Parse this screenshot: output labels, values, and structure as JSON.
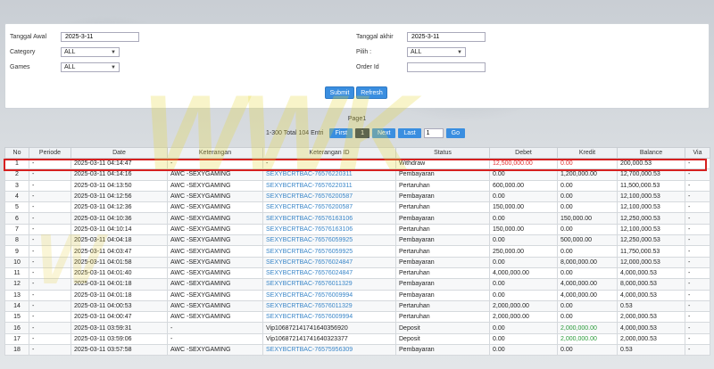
{
  "filters": {
    "tanggal_awal_label": "Tanggal Awal",
    "tanggal_awal_value": "2025-3-11",
    "tanggal_akhir_label": "Tanggal akhir",
    "tanggal_akhir_value": "2025-3-11",
    "category_label": "Category",
    "category_value": "ALL",
    "pilih_label": "Pilih :",
    "pilih_value": "ALL",
    "games_label": "Games",
    "games_value": "ALL",
    "order_id_label": "Order Id",
    "order_id_value": "",
    "submit_label": "Submit",
    "refresh_label": "Refresh"
  },
  "pager": {
    "page_label": "Page1",
    "total_text": "1-300 Total 104 Entri",
    "first": "First",
    "current": "1",
    "next": "Next",
    "last": "Last",
    "page_input": "1",
    "go": "Go"
  },
  "watermark": "WWK",
  "table": {
    "headers": [
      "No",
      "Periode",
      "Date",
      "Keterangan",
      "Keterangan ID",
      "Status",
      "Debet",
      "Kredit",
      "Balance",
      "Via"
    ],
    "rows": [
      [
        "1",
        "-",
        "2025-03-11 04:14:47",
        "-",
        "-",
        "Withdraw",
        "12,500,000.00",
        "0.00",
        "200,000.53",
        "-"
      ],
      [
        "2",
        "-",
        "2025-03-11 04:14:16",
        "AWC -SEXYGAMING",
        "SEXYBCRTBAC-76576220311",
        "Pembayaran",
        "0.00",
        "1,200,000.00",
        "12,700,000.53",
        "-"
      ],
      [
        "3",
        "-",
        "2025-03-11 04:13:50",
        "AWC -SEXYGAMING",
        "SEXYBCRTBAC-76576220311",
        "Pertaruhan",
        "600,000.00",
        "0.00",
        "11,500,000.53",
        "-"
      ],
      [
        "4",
        "-",
        "2025-03-11 04:12:56",
        "AWC -SEXYGAMING",
        "SEXYBCRTBAC-76576200587",
        "Pembayaran",
        "0.00",
        "0.00",
        "12,100,000.53",
        "-"
      ],
      [
        "5",
        "-",
        "2025-03-11 04:12:36",
        "AWC -SEXYGAMING",
        "SEXYBCRTBAC-76576200587",
        "Pertaruhan",
        "150,000.00",
        "0.00",
        "12,100,000.53",
        "-"
      ],
      [
        "6",
        "-",
        "2025-03-11 04:10:36",
        "AWC -SEXYGAMING",
        "SEXYBCRTBAC-76576163106",
        "Pembayaran",
        "0.00",
        "150,000.00",
        "12,250,000.53",
        "-"
      ],
      [
        "7",
        "-",
        "2025-03-11 04:10:14",
        "AWC -SEXYGAMING",
        "SEXYBCRTBAC-76576163106",
        "Pertaruhan",
        "150,000.00",
        "0.00",
        "12,100,000.53",
        "-"
      ],
      [
        "8",
        "-",
        "2025-03-11 04:04:18",
        "AWC -SEXYGAMING",
        "SEXYBCRTBAC-76576059925",
        "Pembayaran",
        "0.00",
        "500,000.00",
        "12,250,000.53",
        "-"
      ],
      [
        "9",
        "-",
        "2025-03-11 04:03:47",
        "AWC -SEXYGAMING",
        "SEXYBCRTBAC-76576059925",
        "Pertaruhan",
        "250,000.00",
        "0.00",
        "11,750,000.53",
        "-"
      ],
      [
        "10",
        "-",
        "2025-03-11 04:01:58",
        "AWC -SEXYGAMING",
        "SEXYBCRTBAC-76576024847",
        "Pembayaran",
        "0.00",
        "8,000,000.00",
        "12,000,000.53",
        "-"
      ],
      [
        "11",
        "-",
        "2025-03-11 04:01:40",
        "AWC -SEXYGAMING",
        "SEXYBCRTBAC-76576024847",
        "Pertaruhan",
        "4,000,000.00",
        "0.00",
        "4,000,000.53",
        "-"
      ],
      [
        "12",
        "-",
        "2025-03-11 04:01:18",
        "AWC -SEXYGAMING",
        "SEXYBCRTBAC-76576011329",
        "Pembayaran",
        "0.00",
        "4,000,000.00",
        "8,000,000.53",
        "-"
      ],
      [
        "13",
        "-",
        "2025-03-11 04:01:18",
        "AWC -SEXYGAMING",
        "SEXYBCRTBAC-76576009994",
        "Pembayaran",
        "0.00",
        "4,000,000.00",
        "4,000,000.53",
        "-"
      ],
      [
        "14",
        "-",
        "2025-03-11 04:00:53",
        "AWC -SEXYGAMING",
        "SEXYBCRTBAC-76576011329",
        "Pertaruhan",
        "2,000,000.00",
        "0.00",
        "0.53",
        "-"
      ],
      [
        "15",
        "-",
        "2025-03-11 04:00:47",
        "AWC -SEXYGAMING",
        "SEXYBCRTBAC-76576009994",
        "Pertaruhan",
        "2,000,000.00",
        "0.00",
        "2,000,000.53",
        "-"
      ],
      [
        "16",
        "-",
        "2025-03-11 03:59:31",
        "-",
        "Vip10687214174164035692​0",
        "Deposit",
        "0.00",
        "2,000,000.00",
        "4,000,000.53",
        "-"
      ],
      [
        "17",
        "-",
        "2025-03-11 03:59:06",
        "-",
        "Vip106872141741640323377",
        "Deposit",
        "0.00",
        "2,000,000.00",
        "2,000,000.53",
        "-"
      ],
      [
        "18",
        "-",
        "2025-03-11 03:57:58",
        "AWC -SEXYGAMING",
        "SEXYBCRTBAC-76575956309",
        "Pembayaran",
        "0.00",
        "0.00",
        "0.53",
        "-"
      ]
    ]
  }
}
